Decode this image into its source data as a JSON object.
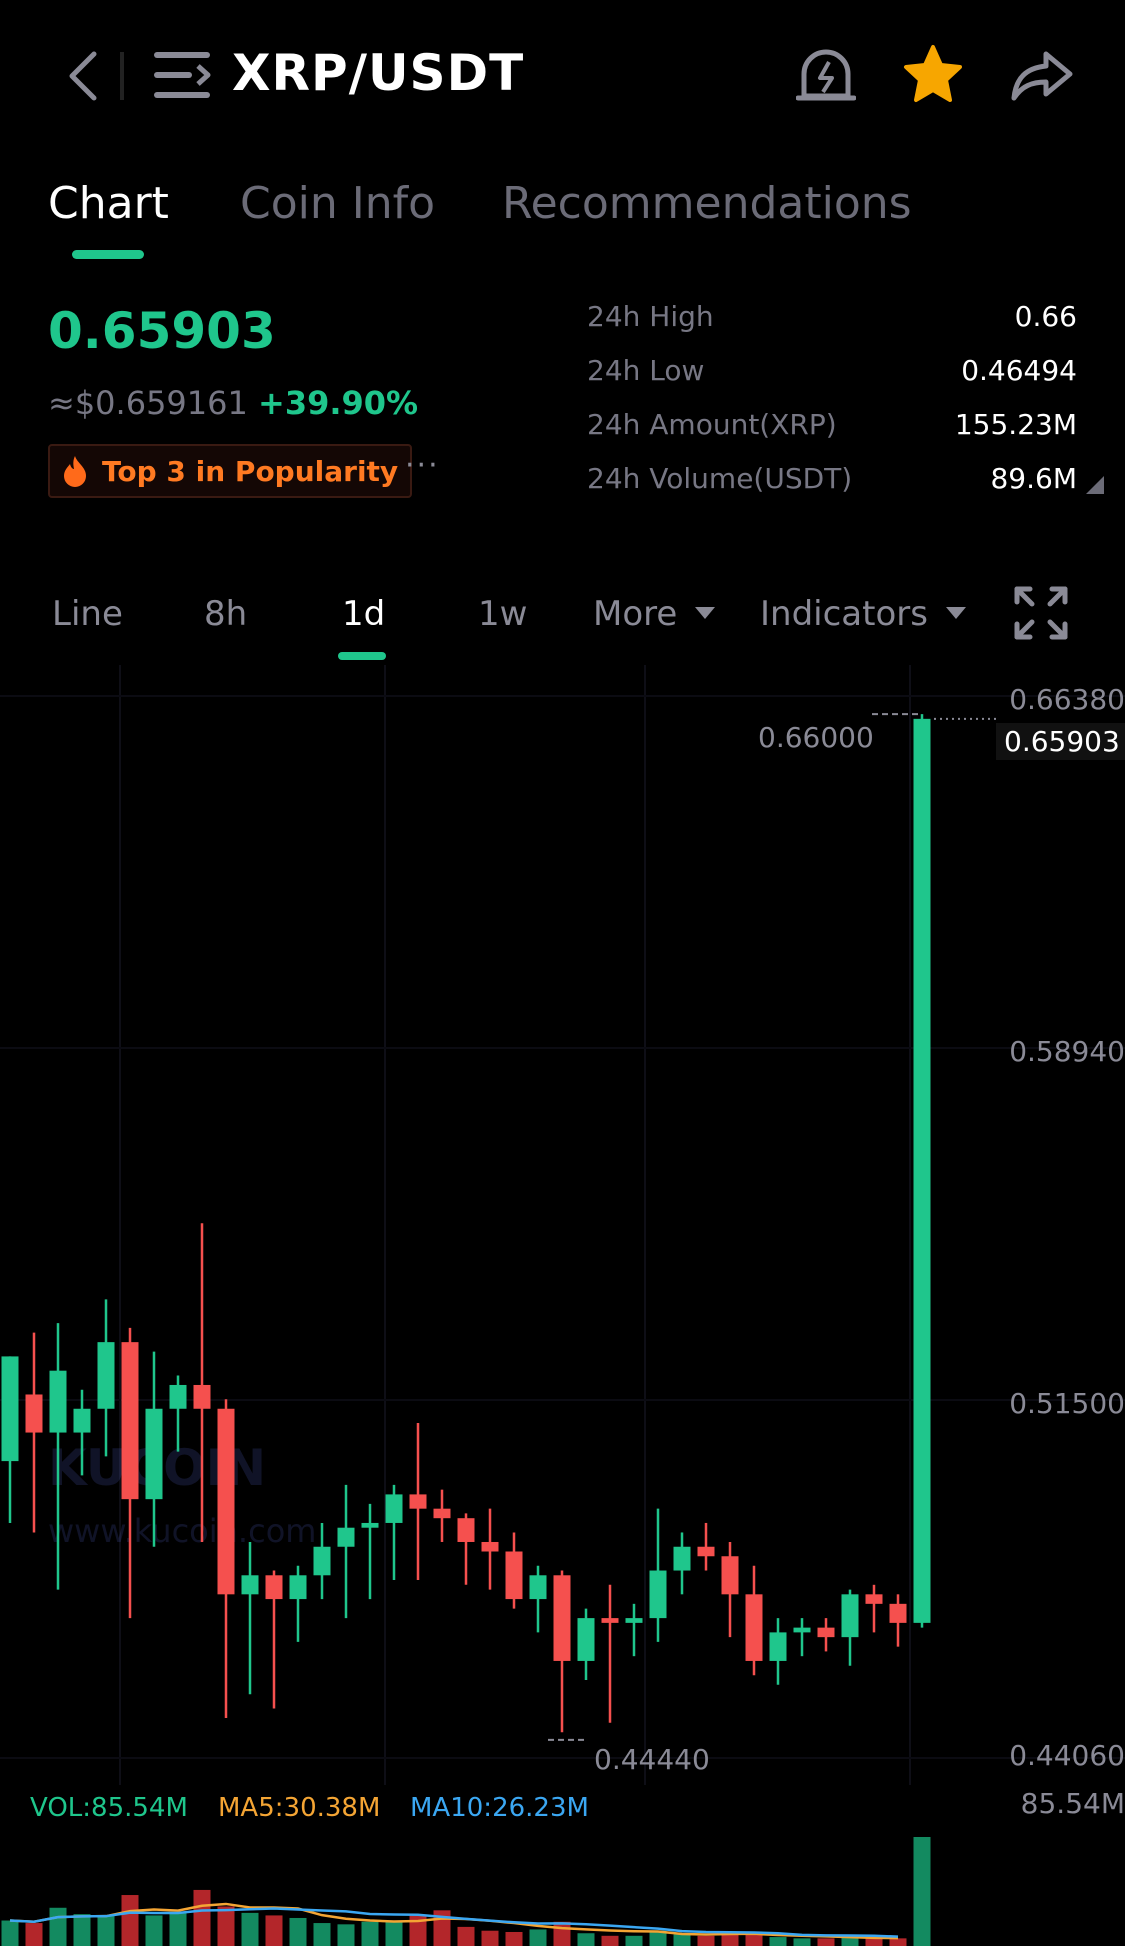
{
  "header": {
    "pair": "XRP/USDT",
    "icons": [
      "back-icon",
      "menu-icon",
      "alert-icon",
      "star-icon",
      "share-icon"
    ],
    "star_color": "#f7a600"
  },
  "tabs": [
    {
      "label": "Chart",
      "active": true
    },
    {
      "label": "Coin Info",
      "active": false
    },
    {
      "label": "Recommendations",
      "active": false
    }
  ],
  "price": {
    "last": "0.65903",
    "usd": "≈$0.659161",
    "change": "+39.90%",
    "badge": "Top 3 in Popularity",
    "more": "···"
  },
  "stats": [
    {
      "label": "24h High",
      "value": "0.66"
    },
    {
      "label": "24h Low",
      "value": "0.46494"
    },
    {
      "label": "24h Amount(XRP)",
      "value": "155.23M"
    },
    {
      "label": "24h Volume(USDT)",
      "value": "89.6M"
    }
  ],
  "intervals": [
    {
      "label": "Line",
      "active": false
    },
    {
      "label": "8h",
      "active": false
    },
    {
      "label": "1d",
      "active": true
    },
    {
      "label": "1w",
      "active": false
    },
    {
      "label": "More",
      "active": false,
      "dropdown": true
    },
    {
      "label": "Indicators",
      "active": false,
      "dropdown": true
    }
  ],
  "chart": {
    "y_ticks": [
      "0.66380",
      "0.58940",
      "0.51500",
      "0.44060"
    ],
    "current_price_tag": "0.65903",
    "high_marker": "0.66000",
    "low_marker": "0.44440",
    "watermark": "KUCOIN",
    "watermark_url": "www.kucoin.com",
    "vol_label": "VOL:85.54M",
    "ma5_label": "MA5:30.38M",
    "ma10_label": "MA10:26.23M",
    "vol_axis_top": "85.54M",
    "colors": {
      "up": "#1fc68c",
      "down": "#f5504e",
      "ma5": "#f4a534",
      "ma10": "#3ba7f2"
    }
  },
  "chart_data": {
    "type": "candlestick",
    "candles": [
      {
        "o": 0.503,
        "h": 0.514,
        "l": 0.49,
        "c": 0.525
      },
      {
        "o": 0.517,
        "h": 0.53,
        "l": 0.488,
        "c": 0.509
      },
      {
        "o": 0.509,
        "h": 0.532,
        "l": 0.476,
        "c": 0.522
      },
      {
        "o": 0.509,
        "h": 0.518,
        "l": 0.5,
        "c": 0.514
      },
      {
        "o": 0.514,
        "h": 0.537,
        "l": 0.504,
        "c": 0.528
      },
      {
        "o": 0.528,
        "h": 0.531,
        "l": 0.47,
        "c": 0.495
      },
      {
        "o": 0.495,
        "h": 0.526,
        "l": 0.485,
        "c": 0.514
      },
      {
        "o": 0.514,
        "h": 0.521,
        "l": 0.505,
        "c": 0.519
      },
      {
        "o": 0.519,
        "h": 0.553,
        "l": 0.486,
        "c": 0.514
      },
      {
        "o": 0.514,
        "h": 0.516,
        "l": 0.449,
        "c": 0.475
      },
      {
        "o": 0.475,
        "h": 0.486,
        "l": 0.454,
        "c": 0.479
      },
      {
        "o": 0.479,
        "h": 0.48,
        "l": 0.451,
        "c": 0.474
      },
      {
        "o": 0.474,
        "h": 0.481,
        "l": 0.465,
        "c": 0.479
      },
      {
        "o": 0.479,
        "h": 0.49,
        "l": 0.474,
        "c": 0.485
      },
      {
        "o": 0.485,
        "h": 0.498,
        "l": 0.47,
        "c": 0.489
      },
      {
        "o": 0.489,
        "h": 0.494,
        "l": 0.474,
        "c": 0.49
      },
      {
        "o": 0.49,
        "h": 0.498,
        "l": 0.478,
        "c": 0.496
      },
      {
        "o": 0.496,
        "h": 0.511,
        "l": 0.478,
        "c": 0.493
      },
      {
        "o": 0.493,
        "h": 0.497,
        "l": 0.486,
        "c": 0.491
      },
      {
        "o": 0.491,
        "h": 0.492,
        "l": 0.477,
        "c": 0.486
      },
      {
        "o": 0.486,
        "h": 0.493,
        "l": 0.476,
        "c": 0.484
      },
      {
        "o": 0.484,
        "h": 0.488,
        "l": 0.472,
        "c": 0.474
      },
      {
        "o": 0.474,
        "h": 0.481,
        "l": 0.467,
        "c": 0.479
      },
      {
        "o": 0.479,
        "h": 0.48,
        "l": 0.446,
        "c": 0.461
      },
      {
        "o": 0.461,
        "h": 0.472,
        "l": 0.457,
        "c": 0.47
      },
      {
        "o": 0.47,
        "h": 0.477,
        "l": 0.448,
        "c": 0.469
      },
      {
        "o": 0.469,
        "h": 0.473,
        "l": 0.462,
        "c": 0.47
      },
      {
        "o": 0.47,
        "h": 0.493,
        "l": 0.465,
        "c": 0.48
      },
      {
        "o": 0.48,
        "h": 0.488,
        "l": 0.475,
        "c": 0.485
      },
      {
        "o": 0.485,
        "h": 0.49,
        "l": 0.48,
        "c": 0.483
      },
      {
        "o": 0.483,
        "h": 0.486,
        "l": 0.466,
        "c": 0.475
      },
      {
        "o": 0.475,
        "h": 0.481,
        "l": 0.458,
        "c": 0.461
      },
      {
        "o": 0.461,
        "h": 0.47,
        "l": 0.456,
        "c": 0.467
      },
      {
        "o": 0.467,
        "h": 0.47,
        "l": 0.462,
        "c": 0.468
      },
      {
        "o": 0.468,
        "h": 0.47,
        "l": 0.463,
        "c": 0.466
      },
      {
        "o": 0.466,
        "h": 0.476,
        "l": 0.46,
        "c": 0.475
      },
      {
        "o": 0.475,
        "h": 0.477,
        "l": 0.467,
        "c": 0.473
      },
      {
        "o": 0.473,
        "h": 0.475,
        "l": 0.464,
        "c": 0.469
      },
      {
        "o": 0.469,
        "h": 0.66,
        "l": 0.468,
        "c": 0.659
      }
    ],
    "volumes_m": [
      20,
      18,
      30,
      25,
      24,
      40,
      24,
      26,
      44,
      31,
      26,
      24,
      22,
      18,
      17,
      19,
      20,
      24,
      28,
      15,
      12,
      11,
      13,
      19,
      10,
      8,
      8,
      12,
      9,
      8,
      10,
      9,
      7,
      6,
      6,
      7,
      6,
      6,
      85.54
    ],
    "ylim": [
      0.4406,
      0.6638
    ],
    "y_ticks": [
      0.6638,
      0.5894,
      0.515,
      0.4406
    ]
  }
}
